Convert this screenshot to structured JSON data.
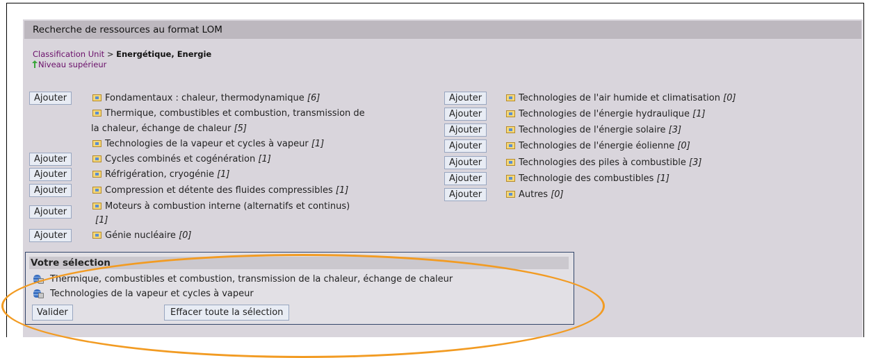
{
  "panel": {
    "title": "Recherche de ressources au format LOM",
    "breadcrumb": {
      "root": "Classification Unit",
      "separator": ">",
      "current": "Energétique, Energie"
    },
    "up_link": "Niveau supérieur"
  },
  "add_button_label": "Ajouter",
  "left_categories": [
    {
      "label": "Fondamentaux : chaleur, thermodynamique",
      "count": "[6]"
    },
    {
      "label_line1": "Thermique, combustibles et combustion, transmission de",
      "label_line2": "la chaleur, échange de chaleur",
      "count": "[5]"
    },
    {
      "label": "Technologies de la vapeur et cycles à vapeur",
      "count": "[1]"
    },
    {
      "label": "Cycles combinés et cogénération",
      "count": "[1]"
    },
    {
      "label": "Réfrigération, cryogénie",
      "count": "[1]"
    },
    {
      "label": "Compression et détente des fluides compressibles",
      "count": "[1]"
    },
    {
      "label_line1": "Moteurs à combustion interne (alternatifs et continus)",
      "count": "[1]"
    },
    {
      "label": "Génie nucléaire",
      "count": "[0]"
    }
  ],
  "right_categories": [
    {
      "label": "Technologies de l'air humide et climatisation",
      "count": "[0]"
    },
    {
      "label": "Technologies de l'énergie hydraulique",
      "count": "[1]"
    },
    {
      "label": "Technologies de l'énergie solaire",
      "count": "[3]"
    },
    {
      "label": "Technologies de l'énergie éolienne",
      "count": "[0]"
    },
    {
      "label": "Technologies des piles à combustible",
      "count": "[3]"
    },
    {
      "label": "Technologie des combustibles",
      "count": "[1]"
    },
    {
      "label": "Autres",
      "count": "[0]"
    }
  ],
  "selection": {
    "title": "Votre sélection",
    "items": [
      "Thermique, combustibles et combustion, transmission de la chaleur, échange de chaleur",
      "Technologies de la vapeur et cycles à vapeur"
    ],
    "validate_label": "Valider",
    "clear_label": "Effacer toute la sélection"
  },
  "colors": {
    "panel_bg": "#d9d5dc",
    "header_bg": "#bdb8bf",
    "link": "#6a0f6a",
    "button_bg": "#e8ecf4",
    "highlight_oval": "#f29b22"
  }
}
